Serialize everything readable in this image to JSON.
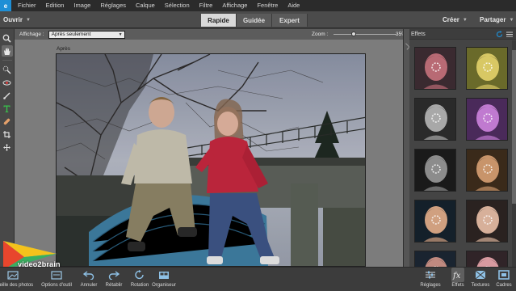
{
  "menubar": {
    "logo_text": "e",
    "items": [
      "Fichier",
      "Edition",
      "Image",
      "Réglages",
      "Calque",
      "Sélection",
      "Filtre",
      "Affichage",
      "Fenêtre",
      "Aide"
    ]
  },
  "modebar": {
    "open_label": "Ouvrir",
    "tabs": [
      {
        "label": "Rapide",
        "active": true
      },
      {
        "label": "Guidée",
        "active": false
      },
      {
        "label": "Expert",
        "active": false
      }
    ],
    "create_label": "Créer",
    "share_label": "Partager"
  },
  "options": {
    "view_label": "Affichage :",
    "view_value": "Après seulement",
    "zoom_label": "Zoom :",
    "zoom_value": "35%",
    "zoom_level": 0.35
  },
  "canvas": {
    "after_label": "Après"
  },
  "panel": {
    "title": "Effets",
    "thumb_count": 10
  },
  "watermark": "video2brain",
  "bottombar": {
    "left": [
      {
        "label": "orbeille des photos",
        "icon": "photo-bin-icon"
      },
      {
        "label": "Options d'outil",
        "icon": "tool-options-icon"
      },
      {
        "label": "Annuler",
        "icon": "undo-icon"
      },
      {
        "label": "Rétablir",
        "icon": "redo-icon"
      },
      {
        "label": "Rotation",
        "icon": "rotate-icon"
      },
      {
        "label": "Organiseur",
        "icon": "organizer-icon"
      }
    ],
    "right": [
      {
        "label": "Réglages",
        "icon": "adjustments-icon"
      },
      {
        "label": "Effets",
        "icon": "fx-icon",
        "active": true
      },
      {
        "label": "Textures",
        "icon": "textures-icon"
      },
      {
        "label": "Cadres",
        "icon": "frames-icon"
      }
    ]
  },
  "colors": {
    "accent": "#1e8fd6",
    "menubar": "#2b2b2b",
    "canvas_bg": "#7c7c7c"
  }
}
